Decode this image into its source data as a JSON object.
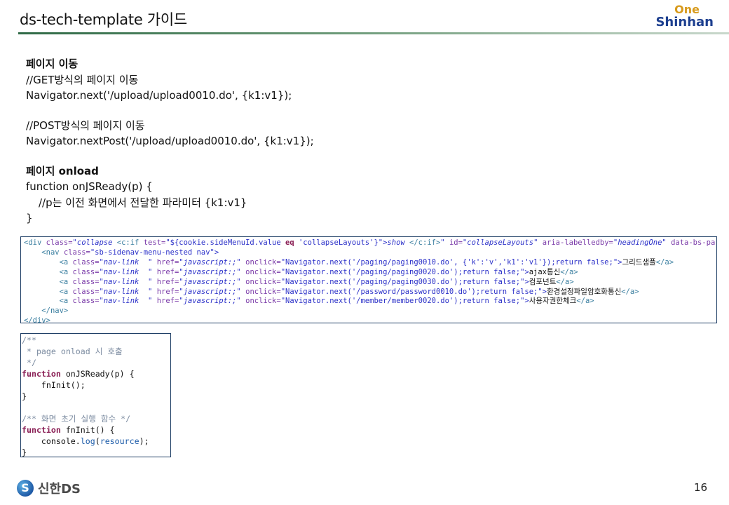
{
  "slide": {
    "title": "ds-tech-template 가이드",
    "page_number": "16"
  },
  "brand": {
    "top_line": "One",
    "bottom_line": "Shinhan",
    "footer_emblem": "S",
    "footer_text": "신한DS"
  },
  "colors": {
    "title_rule": "#2f6a46",
    "brand_gold": "#d79a1c",
    "brand_navy": "#1d3f8f"
  },
  "content": {
    "section1_heading": "페이지 이동",
    "get_comment": "//GET방식의 페이지 이동",
    "get_code": "Navigator.next('/upload/upload0010.do', {k1:v1});",
    "post_comment": "//POST방식의 페이지 이동",
    "post_code": "Navigator.nextPost('/upload/upload0010.do', {k1:v1});",
    "section2_heading": "페이지 onload",
    "fn_open": "function onJSReady(p) {",
    "fn_comment": "//p는 이전 화면에서 전달한 파라미터 {k1:v1}",
    "fn_close": "}"
  },
  "code1": {
    "l1": {
      "a": "<div ",
      "b": "class=",
      "c": "\"collapse ",
      "d": "<c:if ",
      "e": "test=",
      "f": "\"${cookie.sideMenuId.value ",
      "g": "eq",
      "h": " 'collapseLayouts'}\">",
      "i": "show ",
      "j": "</c:if>",
      "k": "\" ",
      "l": "id=",
      "m": "\"collapseLayouts\" ",
      "n": "aria-labelledby=",
      "o": "\"headingOne\" ",
      "p": "data-bs-parent="
    },
    "l2": {
      "a": "<nav ",
      "b": "class=",
      "c": "\"sb-sidenav-menu-nested nav\">"
    },
    "links": [
      {
        "onclick": "\"Navigator.next('/paging/paging0010.do', {'k':'v','k1':'v1'});return false;\">",
        "text": "그리드샘플"
      },
      {
        "onclick": "\"Navigator.next('/paging/paging0020.do');return false;\">",
        "text": "ajax통신"
      },
      {
        "onclick": "\"Navigator.next('/paging/paging0030.do');return false;\">",
        "text": "컴포넌트"
      },
      {
        "onclick": "\"Navigator.next('/password/password0010.do');return false;\">",
        "text": "환경설정파일암호화통신"
      },
      {
        "onclick": "\"Navigator.next('/member/member0020.do');return false;\">",
        "text": "사용자권한체크"
      }
    ],
    "link_parts": {
      "open": "<a ",
      "cls": "class=",
      "clsv": "\"nav-link  ",
      "q": "\" ",
      "href": "href=",
      "hrefv": "\"javascript:;\" ",
      "onclick": "onclick=",
      "close": "</a>"
    },
    "nav_close": "</nav>",
    "div_close": "</div>"
  },
  "code2": {
    "c1": "/**",
    "c2": " * page onload 시 호출",
    "c3": " */",
    "kw_function": "function",
    "f1": " onJSReady(p) {",
    "f2": "    fnInit();",
    "close": "}",
    "c4": "/** 화면 초기 실행 함수 */",
    "f3": " fnInit() {",
    "f4_indent": "    ",
    "f4_obj": "console",
    "f4_dot": ".",
    "f4_method": "log",
    "f4_open": "(",
    "f4_arg": "resource",
    "f4_end": ");"
  }
}
